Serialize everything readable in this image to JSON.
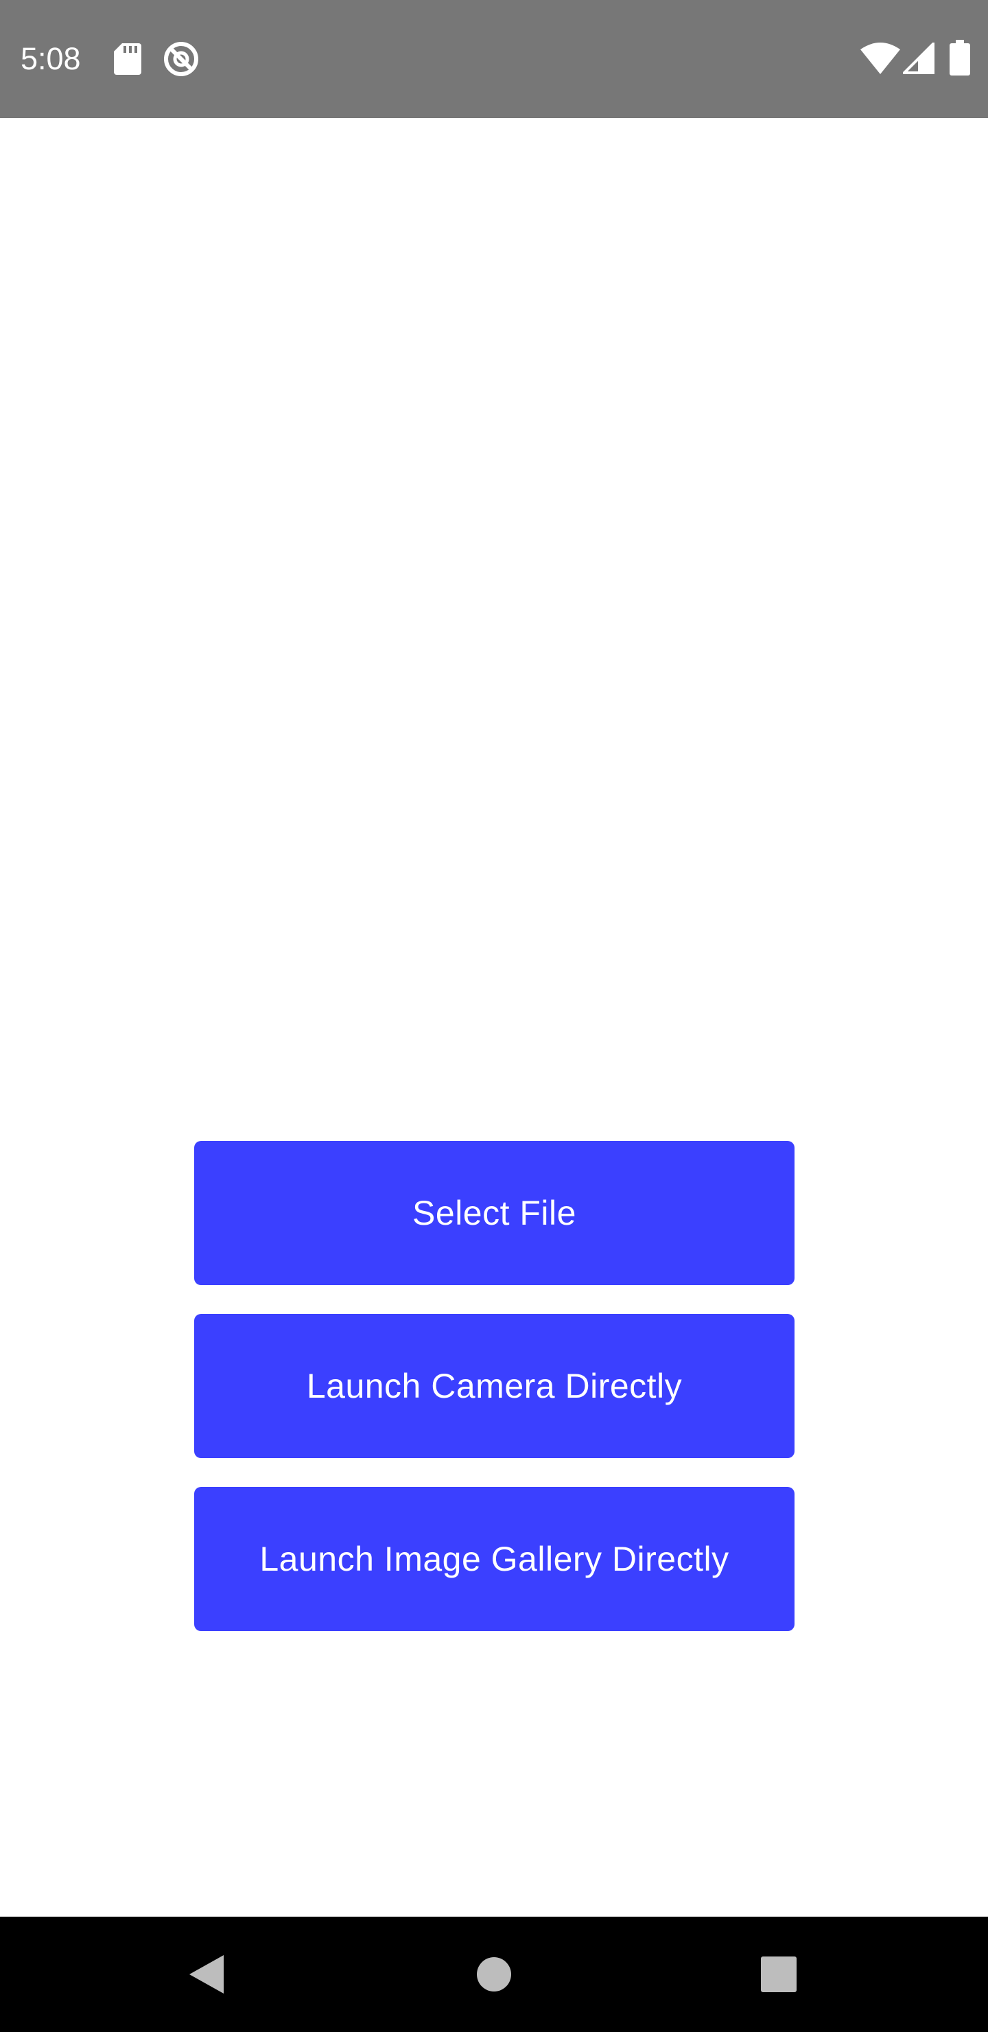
{
  "status_bar": {
    "time": "5:08",
    "left_icons": [
      "sd-card-icon",
      "do-not-disturb-icon"
    ],
    "right_icons": [
      "wifi-icon",
      "cell-signal-icon",
      "battery-icon"
    ],
    "background": "#777777"
  },
  "main": {
    "buttons": [
      {
        "label": "Select File"
      },
      {
        "label": "Launch Camera Directly"
      },
      {
        "label": "Launch Image Gallery Directly"
      }
    ],
    "button_color": "#3b40ff",
    "button_text_color": "#ffffff"
  },
  "nav_bar": {
    "buttons": [
      "back-icon",
      "home-icon",
      "recents-icon"
    ],
    "background": "#000000"
  }
}
